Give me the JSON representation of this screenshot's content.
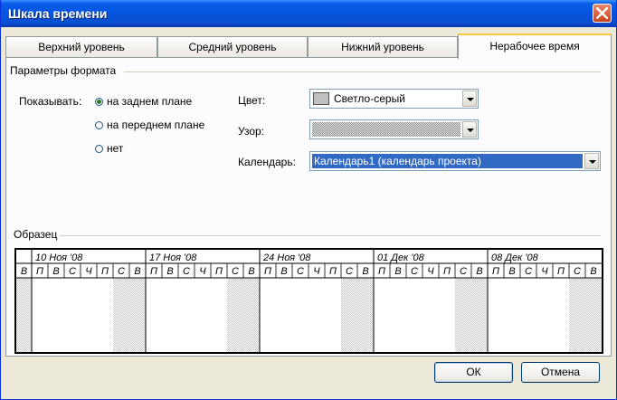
{
  "window": {
    "title": "Шкала времени"
  },
  "tabs": [
    {
      "label": "Верхний уровень"
    },
    {
      "label": "Средний уровень"
    },
    {
      "label": "Нижний уровень"
    },
    {
      "label": "Нерабочее время",
      "active": true
    }
  ],
  "format": {
    "group_label": "Параметры формата",
    "show_label": "Показывать:",
    "options": [
      {
        "label": "на заднем плане",
        "checked": true
      },
      {
        "label": "на переднем плане",
        "checked": false
      },
      {
        "label": "нет",
        "checked": false
      }
    ],
    "color_label": "Цвет:",
    "color_value": "Светло-серый",
    "color_swatch": "#c0c0c0",
    "pattern_label": "Узор:",
    "calendar_label": "Календарь:",
    "calendar_value": "Календарь1 (календарь проекта)"
  },
  "sample": {
    "group_label": "Образец",
    "weeks": [
      "10 Ноя '08",
      "17 Ноя '08",
      "24 Ноя '08",
      "01 Дек '08",
      "08 Дек '08"
    ],
    "lead_day": "В",
    "days": [
      "П",
      "В",
      "С",
      "Ч",
      "П",
      "С",
      "В"
    ],
    "nonworking_color": "#c8c8c8"
  },
  "buttons": {
    "ok": "ОК",
    "cancel": "Отмена"
  }
}
